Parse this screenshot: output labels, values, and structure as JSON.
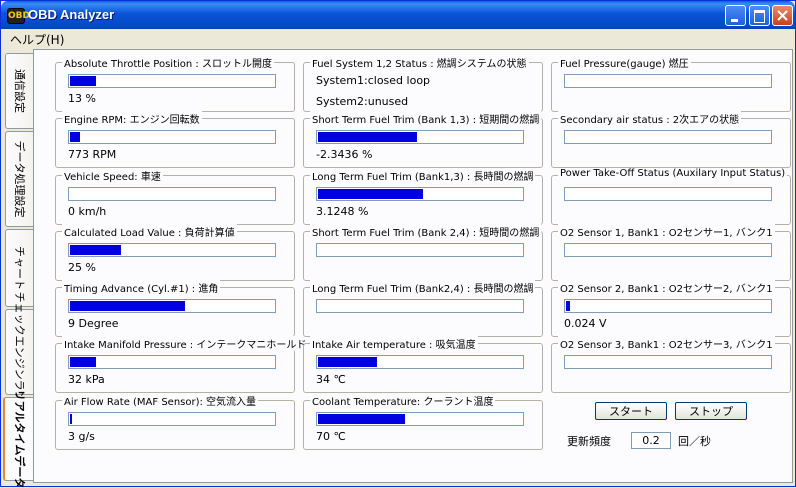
{
  "window": {
    "title": "OBD Analyzer",
    "icon_label": "OBD"
  },
  "menu": {
    "help": "ヘルプ(H)"
  },
  "tabs": [
    {
      "label": "通信設定",
      "active": false
    },
    {
      "label": "データ処理設定",
      "active": false
    },
    {
      "label": "チャート",
      "active": false
    },
    {
      "label": "チェックエンジンランプ",
      "active": false
    },
    {
      "label": "リアルタイムデータ",
      "active": true
    }
  ],
  "col1": [
    {
      "label": "Absolute Throttle Position : スロットル開度",
      "value": "13 %",
      "level": 0.13
    },
    {
      "label": "Engine RPM: エンジン回転数",
      "value": "773 RPM",
      "level": 0.05
    },
    {
      "label": "Vehicle Speed: 車速",
      "value": "0 km/h",
      "level": 0
    },
    {
      "label": "Calculated Load Value : 負荷計算値",
      "value": "25 %",
      "level": 0.25
    },
    {
      "label": "Timing Advance (Cyl.#1) : 進角",
      "value": "9 Degree",
      "level": 0.57
    },
    {
      "label": "Intake Manifold Pressure : インテークマニホールド",
      "value": "32 kPa",
      "level": 0.13
    },
    {
      "label": "Air Flow Rate (MAF Sensor): 空気流入量",
      "value": "3 g/s",
      "level": 0.01
    }
  ],
  "col2": {
    "status": {
      "label": "Fuel System 1,2 Status : 燃調システムの状態",
      "line1": "System1:closed loop",
      "line2": "System2:unused"
    },
    "items": [
      {
        "label": "Short Term Fuel Trim (Bank 1,3) : 短期間の燃調",
        "value": "-2.3436 %",
        "level": 0.49
      },
      {
        "label": "Long Term Fuel Trim (Bank1,3) : 長時間の燃調",
        "value": "3.1248 %",
        "level": 0.52
      },
      {
        "label": "Short Term Fuel Trim (Bank 2,4) : 短時間の燃調",
        "value": "",
        "level": 0
      },
      {
        "label": "Long Term Fuel Trim (Bank2,4) : 長時間の燃調",
        "value": "",
        "level": 0
      },
      {
        "label": "Intake Air temperature : 吸気温度",
        "value": "34 ℃",
        "level": 0.29
      },
      {
        "label": "Coolant Temperature: クーラント温度",
        "value": "70 ℃",
        "level": 0.43
      }
    ]
  },
  "col3": [
    {
      "label": "Fuel Pressure(gauge) 燃圧",
      "value": "",
      "level": 0
    },
    {
      "label": "Secondary air status : 2次エアの状態",
      "value": "",
      "level": 0
    },
    {
      "label": "Power Take-Off Status (Auxilary Input Status)",
      "value": "",
      "level": 0
    },
    {
      "label": "O2 Sensor 1, Bank1 : O2センサー1, バンク1",
      "value": "",
      "level": 0
    },
    {
      "label": "O2 Sensor 2, Bank1 : O2センサー2, バンク1",
      "value": "0.024 V",
      "level": 0.02
    },
    {
      "label": "O2 Sensor 3, Bank1 : O2センサー3, バンク1",
      "value": "",
      "level": 0
    }
  ],
  "controls": {
    "start": "スタート",
    "stop": "ストップ",
    "freq_label": "更新頻度",
    "freq_value": "0.2",
    "freq_unit": "回／秒"
  }
}
